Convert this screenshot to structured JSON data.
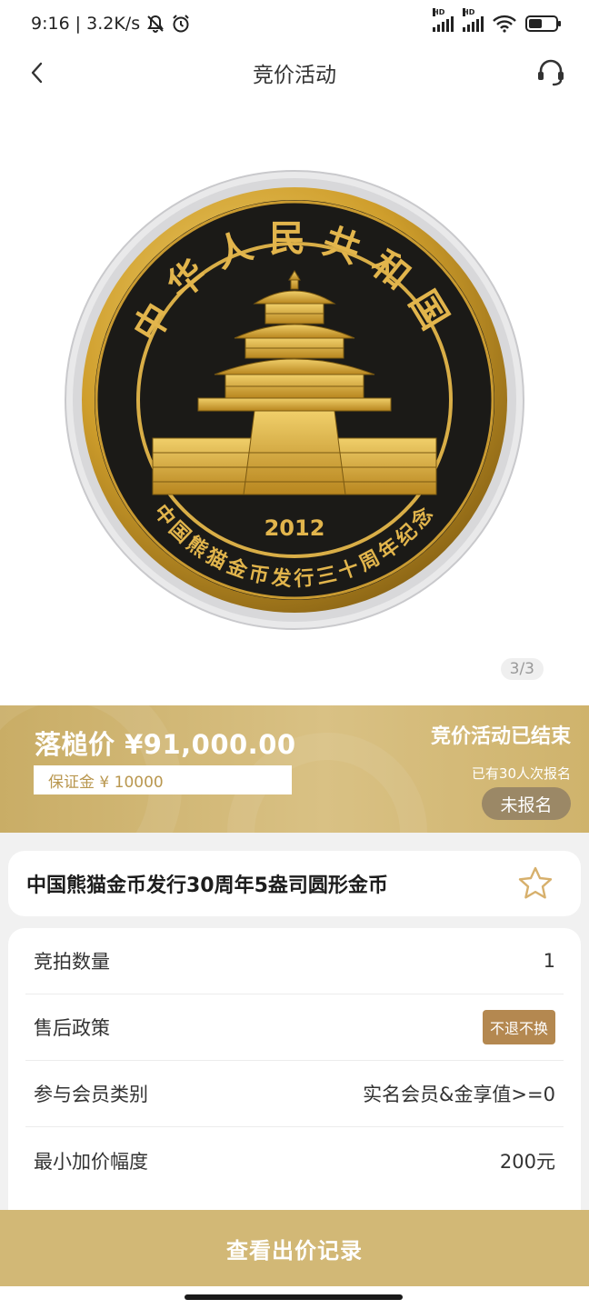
{
  "status_bar": {
    "time": "9:16",
    "net_speed": "| 3.2K/s",
    "battery_level": 0.5
  },
  "header": {
    "title": "竞价活动"
  },
  "gallery": {
    "coin": {
      "top_text": "中华人民共和国",
      "bottom_text": "中国熊猫金币发行三十周年纪念",
      "year": "2012"
    },
    "page_indicator": "3/3"
  },
  "price_band": {
    "hammer_price": "落槌价 ¥91,000.00",
    "deposit": "保证金 ¥ 10000",
    "status": "竞价活动已结束",
    "registered_count": "已有30人次报名",
    "register_button": "未报名"
  },
  "product": {
    "title": "中国熊猫金币发行30周年5盎司圆形金币"
  },
  "info": {
    "rows": [
      {
        "label": "竞拍数量",
        "value": "1"
      },
      {
        "label": "售后政策",
        "value": "不退不换"
      },
      {
        "label": "参与会员类别",
        "value": "实名会员&金享值>=0"
      },
      {
        "label": "最小加价幅度",
        "value": "200元"
      }
    ]
  },
  "bottom_button": {
    "label": "查看出价记录"
  },
  "colors": {
    "gold_band": "#d2b876",
    "badge": "#b48850",
    "register_button": "#9b8866"
  }
}
